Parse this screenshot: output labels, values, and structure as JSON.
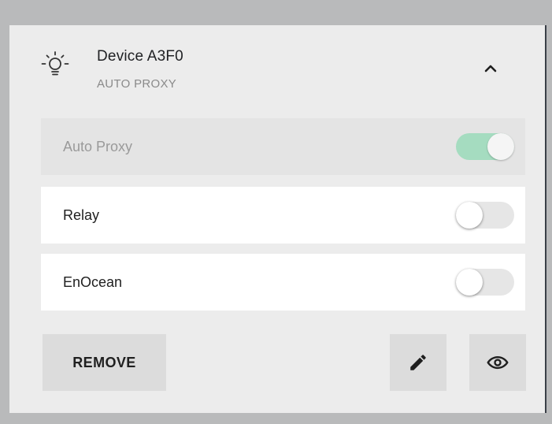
{
  "device": {
    "name": "Device  A3F0",
    "subtitle": "AUTO PROXY",
    "icon": "lightbulb-icon",
    "collapse_icon": "chevron-up-icon"
  },
  "settings": [
    {
      "label": "Auto Proxy",
      "enabled": false,
      "toggle_on": true
    },
    {
      "label": "Relay",
      "enabled": true,
      "toggle_on": false
    },
    {
      "label": "EnOcean",
      "enabled": true,
      "toggle_on": false
    }
  ],
  "actions": {
    "remove_label": "REMOVE",
    "edit_icon": "pencil-icon",
    "view_icon": "eye-icon"
  },
  "colors": {
    "toggle_on_track": "#a5dcc0",
    "card_background": "#ececec",
    "frame": "#b9babb"
  }
}
